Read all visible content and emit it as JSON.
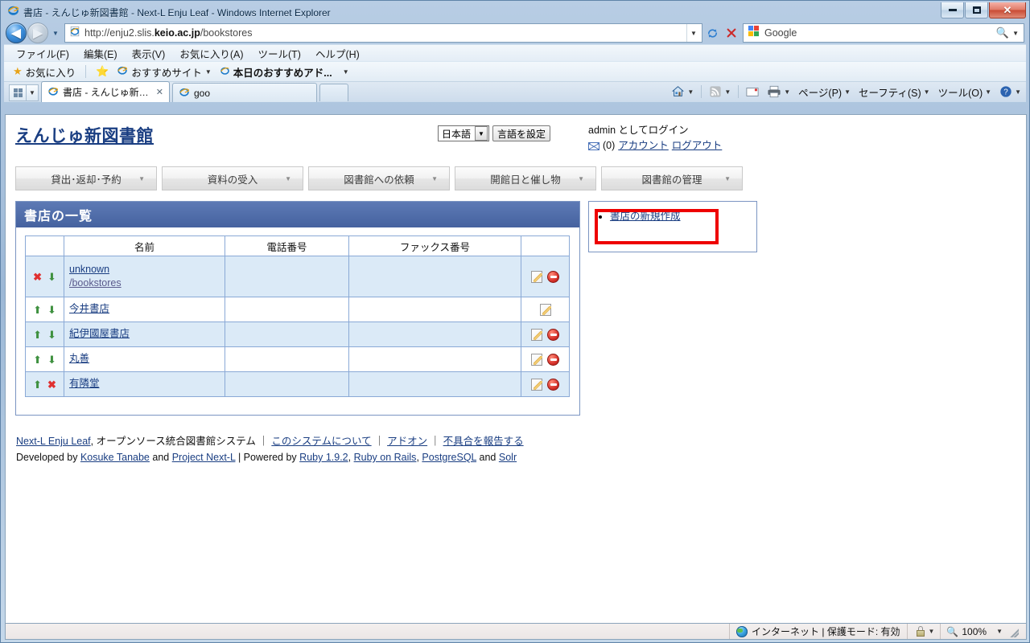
{
  "browser": {
    "window_title": "書店 - えんじゅ新図書館 - Next-L Enju Leaf - Windows Internet Explorer",
    "url_prefix": "http://enju2.slis.",
    "url_bold": "keio.ac.jp",
    "url_suffix": "/bookstores",
    "search_placeholder": "Google",
    "menus": [
      "ファイル(F)",
      "編集(E)",
      "表示(V)",
      "お気に入り(A)",
      "ツール(T)",
      "ヘルプ(H)"
    ],
    "favorites": {
      "favorites_label": "お気に入り",
      "suggested_sites": "おすすめサイト",
      "today_addon": "本日のおすすめアド..."
    },
    "tabs": [
      {
        "label": "書店 - えんじゅ新図書...",
        "active": true
      },
      {
        "label": "goo",
        "active": false
      }
    ],
    "command_bar": [
      "ページ(P)",
      "セーフティ(S)",
      "ツール(O)"
    ],
    "window_controls": {
      "minimize": "minimize-button",
      "maximize": "maximize-button",
      "close": "✕"
    },
    "status": {
      "zone": "インターネット | 保護モード: 有効",
      "zoom": "100%"
    }
  },
  "site": {
    "title": "えんじゅ新図書館",
    "language": {
      "selected": "日本語",
      "set_button": "言語を設定"
    },
    "user": {
      "login_status": "admin としてログイン",
      "message_count": "(0)",
      "account_link": "アカウント",
      "logout_link": "ログアウト"
    },
    "nav": [
      {
        "label": "貸出･返却･予約"
      },
      {
        "label": "資料の受入"
      },
      {
        "label": "図書館への依頼"
      },
      {
        "label": "開館日と催し物"
      },
      {
        "label": "図書館の管理"
      }
    ]
  },
  "panel": {
    "heading": "書店の一覧",
    "columns": [
      "",
      "名前",
      "電話番号",
      "ファックス番号",
      ""
    ],
    "rows": [
      {
        "move": {
          "up": "✖",
          "down": "⬇",
          "up_kind": "x",
          "down_kind": "down"
        },
        "name": "unknown",
        "subname": "/bookstores",
        "tel": "",
        "fax": "",
        "edit": true,
        "delete": true,
        "alt": true
      },
      {
        "move": {
          "up": "⬆",
          "down": "⬇",
          "up_kind": "up",
          "down_kind": "down"
        },
        "name": "今井書店",
        "subname": "",
        "tel": "",
        "fax": "",
        "edit": true,
        "delete": false,
        "alt": false
      },
      {
        "move": {
          "up": "⬆",
          "down": "⬇",
          "up_kind": "up",
          "down_kind": "down"
        },
        "name": "紀伊國屋書店",
        "subname": "",
        "tel": "",
        "fax": "",
        "edit": true,
        "delete": true,
        "alt": true
      },
      {
        "move": {
          "up": "⬆",
          "down": "⬇",
          "up_kind": "up",
          "down_kind": "down"
        },
        "name": "丸善",
        "subname": "",
        "tel": "",
        "fax": "",
        "edit": true,
        "delete": true,
        "alt": false
      },
      {
        "move": {
          "up": "⬆",
          "down": "✖",
          "up_kind": "up",
          "down_kind": "x"
        },
        "name": "有隣堂",
        "subname": "",
        "tel": "",
        "fax": "",
        "edit": true,
        "delete": true,
        "alt": true
      }
    ]
  },
  "sidebar": {
    "items": [
      {
        "label": "書店の新規作成"
      }
    ],
    "highlight_color": "#ee0000"
  },
  "footer": {
    "line1": {
      "product": "Next-L Enju Leaf",
      "desc": ", オープンソース統合図書館システム",
      "sep1": "｜",
      "about": "このシステムについて",
      "sep2": "｜",
      "addon": "アドオン",
      "sep3": "｜",
      "bug": "不具合を報告する"
    },
    "line2": {
      "dev_by": "Developed by",
      "author": "Kosuke Tanabe",
      "and1": "and",
      "project": "Project Next-L",
      "sep": "|",
      "powered": "Powered by",
      "ruby": "Ruby 1.9.2",
      "comma1": ",",
      "rails": "Ruby on Rails",
      "comma2": ",",
      "pg": "PostgreSQL",
      "and2": "and",
      "solr": "Solr"
    }
  }
}
